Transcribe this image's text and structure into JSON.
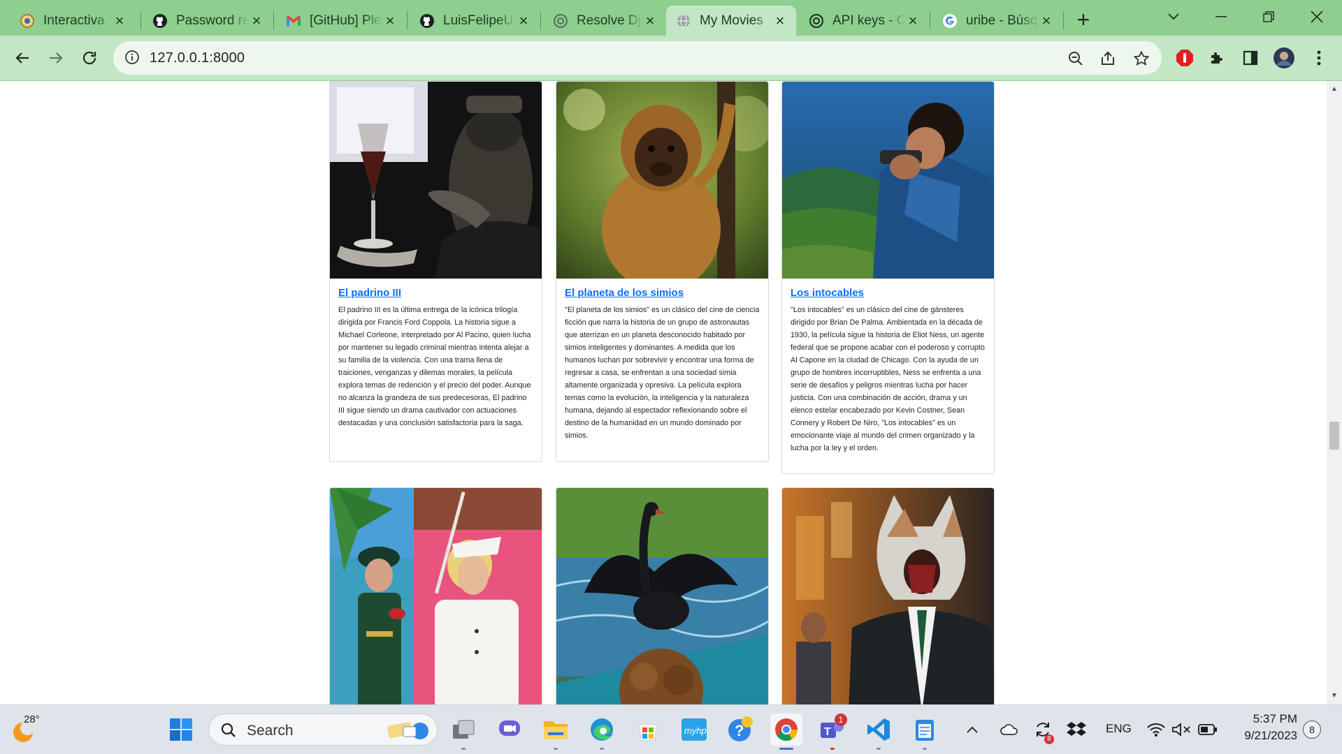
{
  "browser": {
    "tabs": [
      {
        "title": "Interactiva Virtual",
        "favicon": "university-seal-icon"
      },
      {
        "title": "Password reset",
        "favicon": "github-icon"
      },
      {
        "title": "[GitHub] Please",
        "favicon": "gmail-icon"
      },
      {
        "title": "LuisFelipeU",
        "favicon": "github-icon"
      },
      {
        "title": "Resolve Django",
        "favicon": "openai-icon"
      },
      {
        "title": "My Movies",
        "favicon": "globe-icon",
        "active": true
      },
      {
        "title": "API keys - OpenAI",
        "favicon": "openai-icon"
      },
      {
        "title": "uribe - Búsqueda",
        "favicon": "google-icon"
      }
    ],
    "new_tab": "+",
    "url": "127.0.0.1:8000",
    "accent": "#8ecf8f"
  },
  "movies": [
    {
      "title": "El padrino III",
      "description": "El padrino III es la última entrega de la icónica trilogía dirigida por Francis Ford Coppola. La historia sigue a Michael Corleone, interpretado por Al Pacino, quien lucha por mantener su legado criminal mientras intenta alejar a su familia de la violencia. Con una trama llena de traiciones, venganzas y dilemas morales, la película explora temas de redención y el precio del poder. Aunque no alcanza la grandeza de sus predecesoras, El padrino III sigue siendo un drama cautivador con actuaciones destacadas y una conclusión satisfactoria para la saga."
    },
    {
      "title": "El planeta de los simios",
      "description": "\"El planeta de los simios\" es un clásico del cine de ciencia ficción que narra la historia de un grupo de astronautas que aterrizan en un planeta desconocido habitado por simios inteligentes y dominantes. A medida que los humanos luchan por sobrevivir y encontrar una forma de regresar a casa, se enfrentan a una sociedad simia altamente organizada y opresiva. La película explora temas como la evolución, la inteligencia y la naturaleza humana, dejando al espectador reflexionando sobre el destino de la humanidad en un mundo dominado por simios."
    },
    {
      "title": "Los intocables",
      "description": "\"Los intocables\" es un clásico del cine de gánsteres dirigido por Brian De Palma. Ambientada en la década de 1930, la película sigue la historia de Eliot Ness, un agente federal que se propone acabar con el poderoso y corrupto Al Capone en la ciudad de Chicago. Con la ayuda de un grupo de hombres incorruptibles, Ness se enfrenta a una serie de desafíos y peligros mientras lucha por hacer justicia. Con una combinación de acción, drama y un elenco estelar encabezado por Kevin Costner, Sean Connery y Robert De Niro, \"Los intocables\" es un emocionante viaje al mundo del crimen organizado y la lucha por la ley y el orden."
    }
  ],
  "taskbar": {
    "weather_temp": "28°",
    "search_label": "Search",
    "language": "ENG",
    "time": "5:37 PM",
    "date": "9/21/2023",
    "notification_count": "8",
    "teams_badge": "1",
    "mail_badge": "8"
  }
}
